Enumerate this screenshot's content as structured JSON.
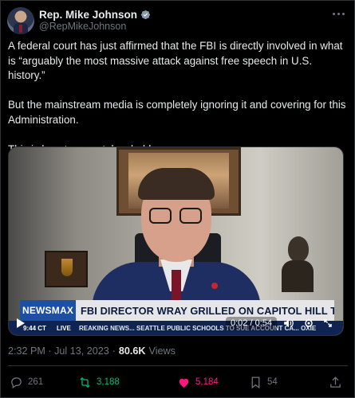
{
  "author": {
    "display_name": "Rep. Mike Johnson",
    "handle": "@RepMikeJohnson",
    "verified": true
  },
  "tweet": {
    "paragraphs": [
      "A federal court has just affirmed that the FBI is directly involved in what is “arguably the most massive attack against free speech in U.S. history.”",
      "But the mainstream media is completely ignoring it and covering for this Administration.",
      "This is how tyranny takes hold."
    ]
  },
  "video": {
    "network": "NEWSMAX",
    "headline": "FBI DIRECTOR WRAY GRILLED ON CAPITOL HILL TODAY",
    "ticker_time": "9:44 CT",
    "ticker_live": "LIVE",
    "ticker_text": "REAKING NEWS...      SEATTLE PUBLIC SCHOOLS TO SUE ACCOUNT CA... OXIE",
    "time_display": "0:02 / 0:54",
    "progress_fraction": 0.04
  },
  "meta": {
    "timestamp": "2:32 PM · Jul 13, 2023",
    "separator": "·",
    "views_count": "80.6K",
    "views_label": "Views"
  },
  "actions": {
    "replies": "261",
    "reposts": "3,188",
    "likes": "5,184",
    "bookmarks": "54"
  },
  "colors": {
    "background": "#000000",
    "text": "#e7e9ea",
    "secondary": "#71767b",
    "accent": "#1d9bf0",
    "repost_active": "#00ba7c",
    "like_active": "#f91880"
  },
  "icons": [
    "verified-badge-icon",
    "more-icon",
    "play-icon",
    "volume-icon",
    "settings-icon",
    "expand-icon",
    "reply-icon",
    "repost-icon",
    "like-icon",
    "bookmark-icon",
    "share-icon"
  ]
}
